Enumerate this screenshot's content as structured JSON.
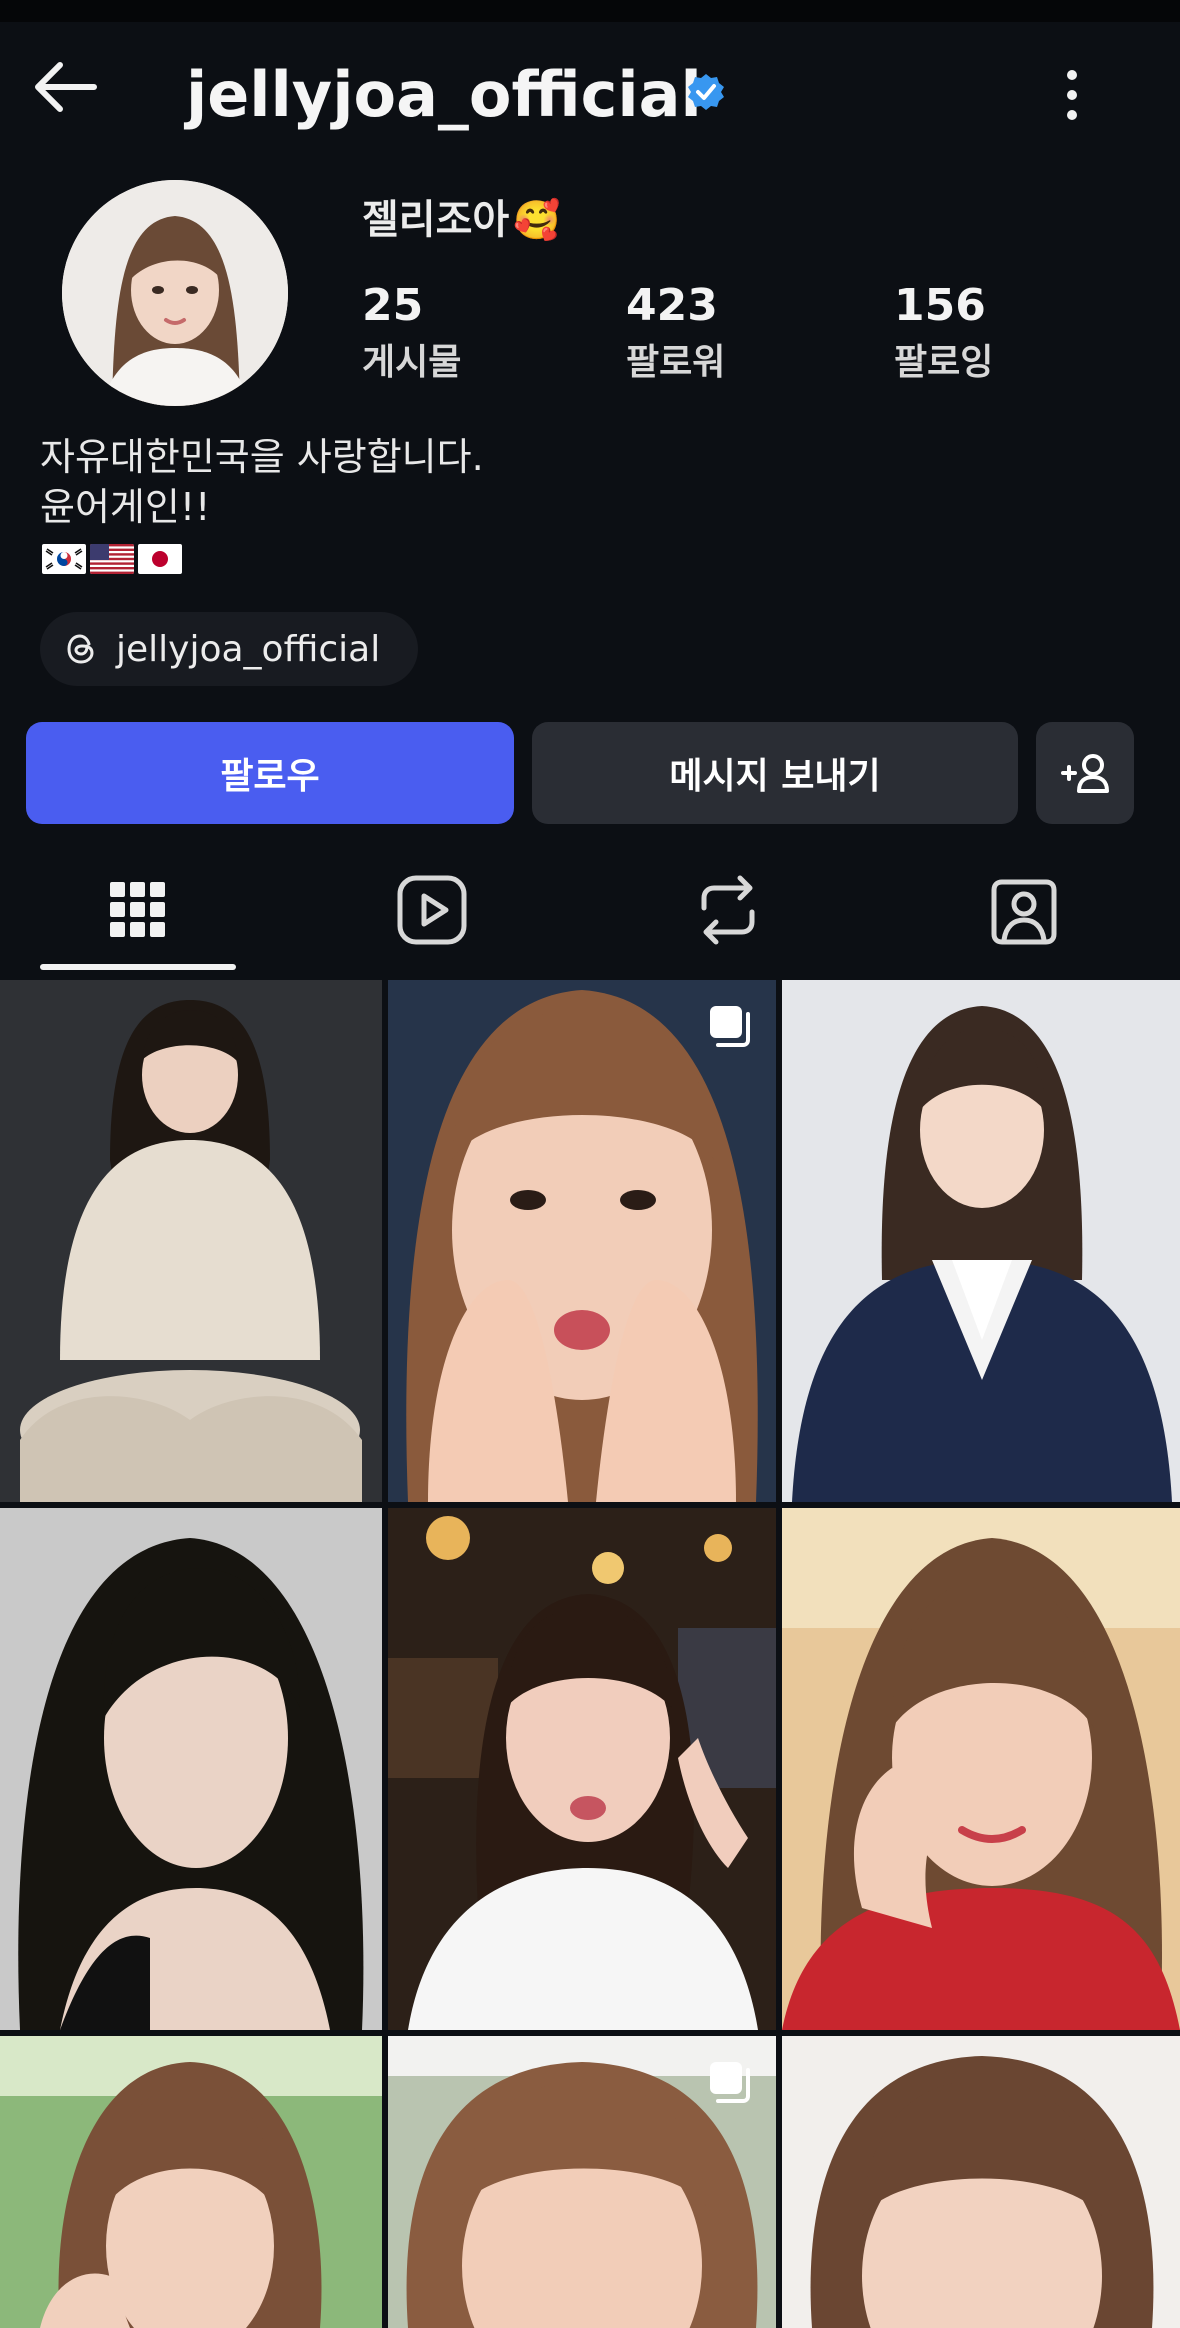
{
  "header": {
    "username": "jellyjoa_official",
    "verified": true
  },
  "profile": {
    "display_name": "젤리조아",
    "display_emoji": "🥰",
    "stats": [
      {
        "value": "25",
        "label": "게시물"
      },
      {
        "value": "423",
        "label": "팔로워"
      },
      {
        "value": "156",
        "label": "팔로잉"
      }
    ],
    "bio_lines": [
      "자유대한민국을 사랑합니다.",
      "윤어게인!!"
    ],
    "flags": [
      "South Korea",
      "United States",
      "Japan"
    ],
    "threads_handle": "jellyjoa_official"
  },
  "actions": {
    "follow_label": "팔로우",
    "message_label": "메시지 보내기"
  },
  "tabs": [
    {
      "icon": "grid-icon",
      "active": true
    },
    {
      "icon": "reels-icon",
      "active": false
    },
    {
      "icon": "reposts-icon",
      "active": false
    },
    {
      "icon": "tagged-icon",
      "active": false
    }
  ],
  "posts": [
    {
      "index": 1,
      "multi": false
    },
    {
      "index": 2,
      "multi": true
    },
    {
      "index": 3,
      "multi": false
    },
    {
      "index": 4,
      "multi": false
    },
    {
      "index": 5,
      "multi": false
    },
    {
      "index": 6,
      "multi": false
    },
    {
      "index": 7,
      "multi": false
    },
    {
      "index": 8,
      "multi": true
    },
    {
      "index": 9,
      "multi": false
    }
  ],
  "colors": {
    "background": "#0c0f14",
    "follow_button": "#4a5df0",
    "secondary_button": "#2a2d34",
    "verified_badge": "#3897f0"
  }
}
